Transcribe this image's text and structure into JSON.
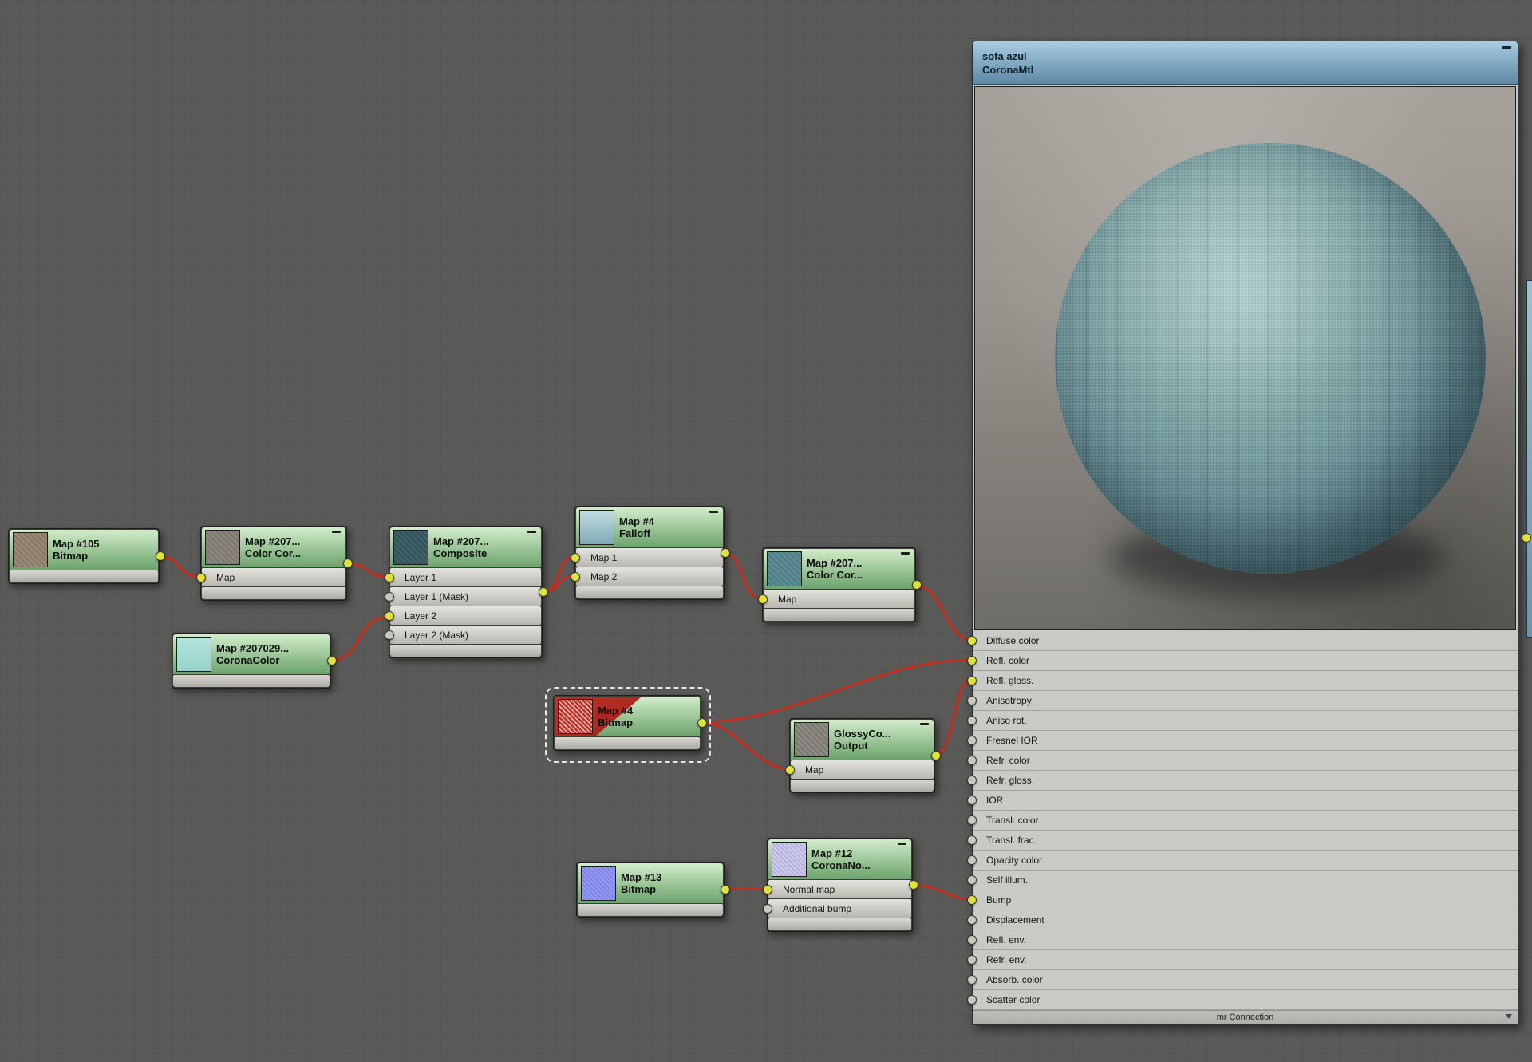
{
  "canvas": {
    "bg": "#5a5a58"
  },
  "nodes": {
    "map105": {
      "title": "Map #105",
      "subtitle": "Bitmap"
    },
    "cc1": {
      "title": "Map #207...",
      "subtitle": "Color Cor...",
      "slots": [
        "Map"
      ]
    },
    "coronacolor": {
      "title": "Map #207029...",
      "subtitle": "CoronaColor"
    },
    "composite": {
      "title": "Map #207...",
      "subtitle": "Composite",
      "slots": [
        "Layer 1",
        "Layer 1 (Mask)",
        "Layer 2",
        "Layer 2 (Mask)"
      ]
    },
    "falloff": {
      "title": "Map #4",
      "subtitle": "Falloff",
      "slots": [
        "Map 1",
        "Map 2"
      ]
    },
    "cc2": {
      "title": "Map #207...",
      "subtitle": "Color Cor...",
      "slots": [
        "Map"
      ]
    },
    "bitmap4": {
      "title": "Map #4",
      "subtitle": "Bitmap"
    },
    "glossy": {
      "title": "GlossyCo...",
      "subtitle": "Output",
      "slots": [
        "Map"
      ]
    },
    "bitmap13": {
      "title": "Map #13",
      "subtitle": "Bitmap"
    },
    "coronanormal": {
      "title": "Map #12",
      "subtitle": "CoronaNo...",
      "slots": [
        "Normal map",
        "Additional bump"
      ]
    }
  },
  "material": {
    "title": "sofa azul",
    "type": "CoronaMtl",
    "params": [
      "Diffuse color",
      "Refl. color",
      "Refl. gloss.",
      "Anisotropy",
      "Aniso rot.",
      "Fresnel IOR",
      "Refr. color",
      "Refr. gloss.",
      "IOR",
      "Transl. color",
      "Transl. frac.",
      "Opacity color",
      "Self illum.",
      "Bump",
      "Displacement",
      "Refl. env.",
      "Refr. env.",
      "Absorb. color",
      "Scatter color"
    ],
    "footer": "mr Connection"
  },
  "colors": {
    "canvas_bg": "#5a5a58",
    "wire": "#c62c1e",
    "socket_on": "#dfe23a",
    "node_green_top": "#d2ecca",
    "node_green_bottom": "#6ba36c",
    "mtl_header_top": "#a9cde0",
    "mtl_header_bottom": "#5d88a5"
  }
}
